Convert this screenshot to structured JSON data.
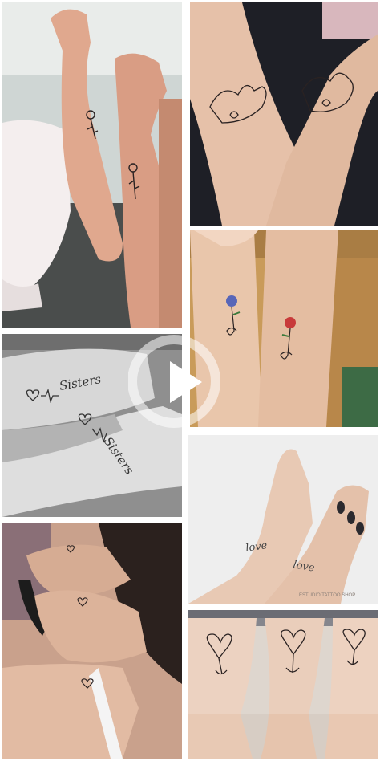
{
  "collage": {
    "tiles": [
      {
        "name": "tile-rose-wrist-tattoos",
        "subject": "two forearms with small rose tattoos"
      },
      {
        "name": "tile-pinky-promise-tattoos",
        "subject": "two forearms with pinky promise line tattoos"
      },
      {
        "name": "tile-infinity-rose-tattoos",
        "subject": "two wrists with colored rose infinity tattoos"
      },
      {
        "name": "tile-sisters-heartbeat-tattoos",
        "subject": "two arms with heartbeat Sisters script tattoos"
      },
      {
        "name": "tile-love-script-tattoos",
        "subject": "two wrists with love script tattoos"
      },
      {
        "name": "tile-shoulder-heart-tattoos",
        "subject": "shoulders with small heart tattoos"
      },
      {
        "name": "tile-heart-anchor-leg-tattoos",
        "subject": "three legs with heart anchor tattoos"
      }
    ],
    "tattoo_text": {
      "sisters_1": "Sisters",
      "sisters_2": "Sisters",
      "love_1": "love",
      "love_2": "love"
    },
    "watermark": "ESTUDIO TATTOO SHOP",
    "play_icon": "play-icon"
  }
}
